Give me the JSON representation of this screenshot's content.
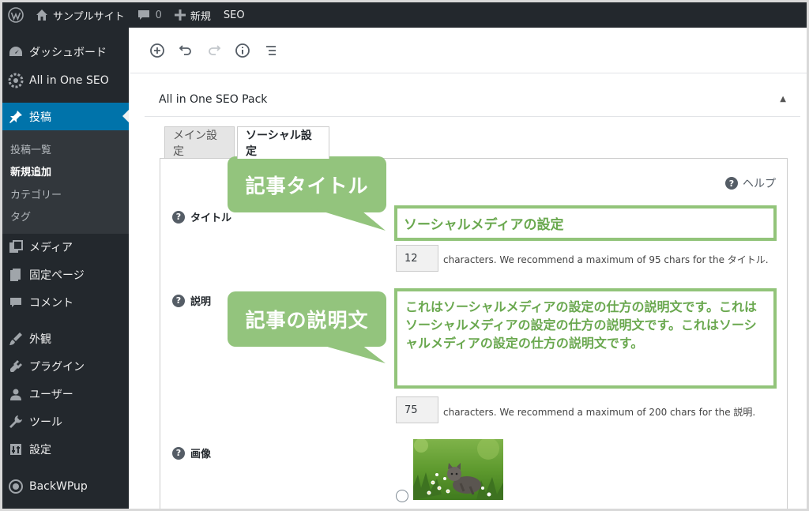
{
  "admin_bar": {
    "site_name": "サンプルサイト",
    "comments_count": "0",
    "new_label": "新規",
    "seo_label": "SEO"
  },
  "sidebar": {
    "items": [
      {
        "label": "ダッシュボード",
        "icon": "dashboard-icon"
      },
      {
        "label": "All in One SEO",
        "icon": "gear-icon"
      },
      {
        "label": "投稿",
        "icon": "pushpin-icon"
      },
      {
        "label": "メディア",
        "icon": "media-icon"
      },
      {
        "label": "固定ページ",
        "icon": "page-icon"
      },
      {
        "label": "コメント",
        "icon": "comment-icon"
      },
      {
        "label": "外観",
        "icon": "brush-icon"
      },
      {
        "label": "プラグイン",
        "icon": "plugin-icon"
      },
      {
        "label": "ユーザー",
        "icon": "user-icon"
      },
      {
        "label": "ツール",
        "icon": "wrench-icon"
      },
      {
        "label": "設定",
        "icon": "settings-icon"
      },
      {
        "label": "BackWPup",
        "icon": "backwpup-icon"
      }
    ],
    "submenu": [
      "投稿一覧",
      "新規追加",
      "カテゴリー",
      "タグ"
    ]
  },
  "panel": {
    "title": "All in One SEO Pack",
    "tabs": [
      "メイン設定",
      "ソーシャル設定"
    ],
    "help_label": "ヘルプ"
  },
  "fields": {
    "title": {
      "label": "タイトル",
      "value": "ソーシャルメディアの設定",
      "count": "12",
      "hint": "characters. We recommend a maximum of 95 chars for the タイトル."
    },
    "description": {
      "label": "説明",
      "value": "これはソーシャルメディアの設定の仕方の説明文です。これはソーシャルメディアの設定の仕方の説明文です。これはソーシャルメディアの設定の仕方の説明文です。",
      "count": "75",
      "hint": "characters. We recommend a maximum of 200 chars for the 説明."
    },
    "image": {
      "label": "画像"
    }
  },
  "callouts": {
    "title": "記事タイトル",
    "description": "記事の説明文"
  },
  "colors": {
    "admin_dark": "#23282d",
    "current_menu": "#0073aa",
    "annotation_green": "#93c47d",
    "annotation_text": "#6aa84f"
  }
}
